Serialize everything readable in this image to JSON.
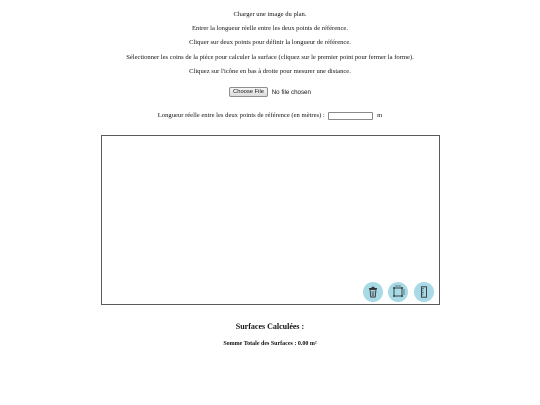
{
  "instructions": [
    "Charger une image du plan.",
    "Entrer la longueur réelle entre les deux points de référence.",
    "Cliquer sur deux points pour définir la longueur de référence.",
    "Sélectionner les coins de la pièce pour calculer la surface (cliquez sur le premier point pour fermer la forme).",
    "Cliquez sur l'icône en bas à droite pour mesurer une distance."
  ],
  "file_input": {
    "button_label": "Choose File",
    "status": "No file chosen"
  },
  "length_field": {
    "label": "Longueur réelle entre les deux points de référence (en mètres) :",
    "value": "",
    "unit": "m"
  },
  "toolbar": {
    "buttons": [
      {
        "name": "delete",
        "icon": "trash-icon"
      },
      {
        "name": "room",
        "icon": "room-shape-icon"
      },
      {
        "name": "measure",
        "icon": "ruler-icon"
      }
    ],
    "color": "#a7d9e6"
  },
  "results": {
    "title": "Surfaces Calculées :",
    "total_label": "Somme Totale des Surfaces : 0.00 m²"
  }
}
